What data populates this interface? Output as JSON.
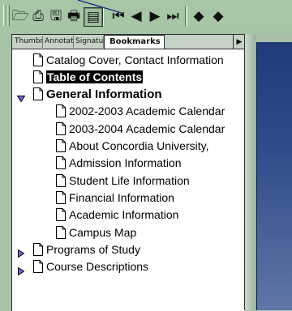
{
  "toolbar": {
    "buttons": [
      {
        "name": "open-icon",
        "glyph": "🗁"
      },
      {
        "name": "print-icon",
        "glyph": "⎙"
      },
      {
        "name": "save-icon",
        "glyph": "🖫"
      },
      {
        "name": "print-alt-icon",
        "glyph": "🖶"
      },
      {
        "name": "show-navigation-pane-icon",
        "glyph": "▤",
        "pressed": true
      },
      {
        "name": "first-page-icon",
        "glyph": "⏮"
      },
      {
        "name": "previous-page-icon",
        "glyph": "◀"
      },
      {
        "name": "next-page-icon",
        "glyph": "▶"
      },
      {
        "name": "last-page-icon",
        "glyph": "⏭"
      },
      {
        "name": "go-back-icon",
        "glyph": "◆"
      },
      {
        "name": "go-forward-icon",
        "glyph": "◆"
      }
    ]
  },
  "nav": {
    "tabs": [
      "Thumbnails",
      "Annotations",
      "Signatures",
      "Bookmarks"
    ],
    "active_tab": "Bookmarks",
    "menu_arrow": "▶"
  },
  "bookmarks": [
    {
      "label": "Catalog Cover, Contact Information",
      "level": 0,
      "twisty": "none"
    },
    {
      "label": "Table of Contents",
      "level": 0,
      "twisty": "none",
      "selected": true
    },
    {
      "label": "General Information",
      "level": 0,
      "twisty": "open",
      "bold": true
    },
    {
      "label": "2002-2003 Academic Calendar",
      "level": 1,
      "twisty": "none"
    },
    {
      "label": "2003-2004 Academic Calendar",
      "level": 1,
      "twisty": "none"
    },
    {
      "label": "About Concordia University,",
      "level": 1,
      "twisty": "none"
    },
    {
      "label": "Admission Information",
      "level": 1,
      "twisty": "none"
    },
    {
      "label": "Student Life Information",
      "level": 1,
      "twisty": "none"
    },
    {
      "label": "Financial Information",
      "level": 1,
      "twisty": "none"
    },
    {
      "label": "Academic Information",
      "level": 1,
      "twisty": "none"
    },
    {
      "label": "Campus Map",
      "level": 1,
      "twisty": "none"
    },
    {
      "label": "Programs of Study",
      "level": 0,
      "twisty": "closed"
    },
    {
      "label": "Course Descriptions",
      "level": 0,
      "twisty": "closed"
    }
  ],
  "colors": {
    "toolbar_bg": "#a6c6a6",
    "twisty_fill": "#6a6ad8",
    "tooltip_line": "#1a2a8a",
    "document_blue": "#2f4c8a"
  }
}
